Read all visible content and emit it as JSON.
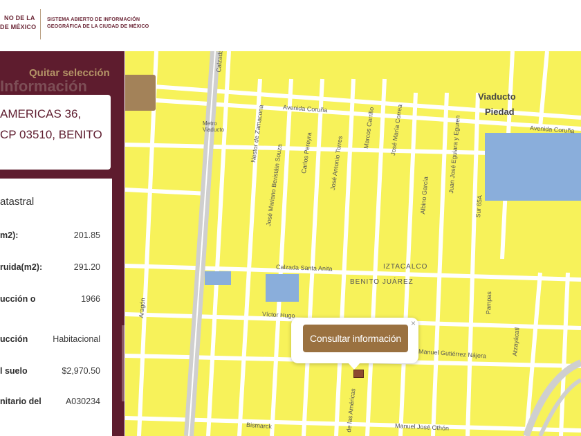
{
  "header": {
    "gov_line1": "NO DE LA",
    "gov_line2": "DE MÉXICO",
    "system_line1": "SISTEMA ABIERTO DE INFORMACIÓN",
    "system_line2": "GEOGRÁFICA DE LA CIUDAD DE MÉXICO"
  },
  "sidebar": {
    "quitar_label": "Quitar selección",
    "section_ghost": "Información",
    "address_line1": "AMERICAS 36,",
    "address_line2": "CP 03510, BENITO",
    "panel_title": "atastral",
    "rows": [
      {
        "label": "m2):",
        "value": "201.85"
      },
      {
        "label": "ruida(m2):",
        "value": "291.20"
      },
      {
        "label": "ucción o",
        "value": "1966"
      },
      {
        "label": "ucción",
        "value": "Habitacional"
      },
      {
        "label": "l suelo",
        "value": "$2,970.50"
      },
      {
        "label": "nitario del",
        "value": "A030234"
      }
    ]
  },
  "map": {
    "labels": {
      "calzada_top": "Calzada",
      "viaducto1": "Viaducto",
      "viaducto2": "Piedad",
      "avenida_coruna": "Avenida Coruña",
      "avenida_coruna2": "Avenida Coruña",
      "metro": "Metro Viaducto",
      "calzada_santa_anita": "Calzada Santa Anita",
      "iztacalco": "IZTACALCO",
      "benito_juarez": "BENITO JUÁREZ",
      "victor_hugo": "Víctor Hugo",
      "manuel_gutierrez": "Manuel Gutiérrez Nájera",
      "manuel_jose": "Manuel José Othón",
      "bismarck": "Bismarck",
      "pampas": "Pampas",
      "atzayacatl": "Atzayácatl",
      "aragon": "Aragón",
      "nestor": "Nestor de Zamacona",
      "jose_mariano": "José Mariano Beristáin Souza",
      "carlos": "Carlos Pereyra",
      "jose_antonio": "José Antonio Torres",
      "marcos": "Marcos Carrillo",
      "jose_maria": "José María Correa",
      "albino": "Albino García",
      "juan_jose": "Juan José Eguiara y Eguren",
      "sur65a": "Sur 65A",
      "americas": "de las Américas"
    },
    "popup": {
      "close_label": "×",
      "button_label": "Consultar información"
    },
    "colors": {
      "block": "#f7f25a",
      "park": "#8aaedb",
      "road": "#ffffff",
      "highway": "#bfbfbf"
    }
  }
}
